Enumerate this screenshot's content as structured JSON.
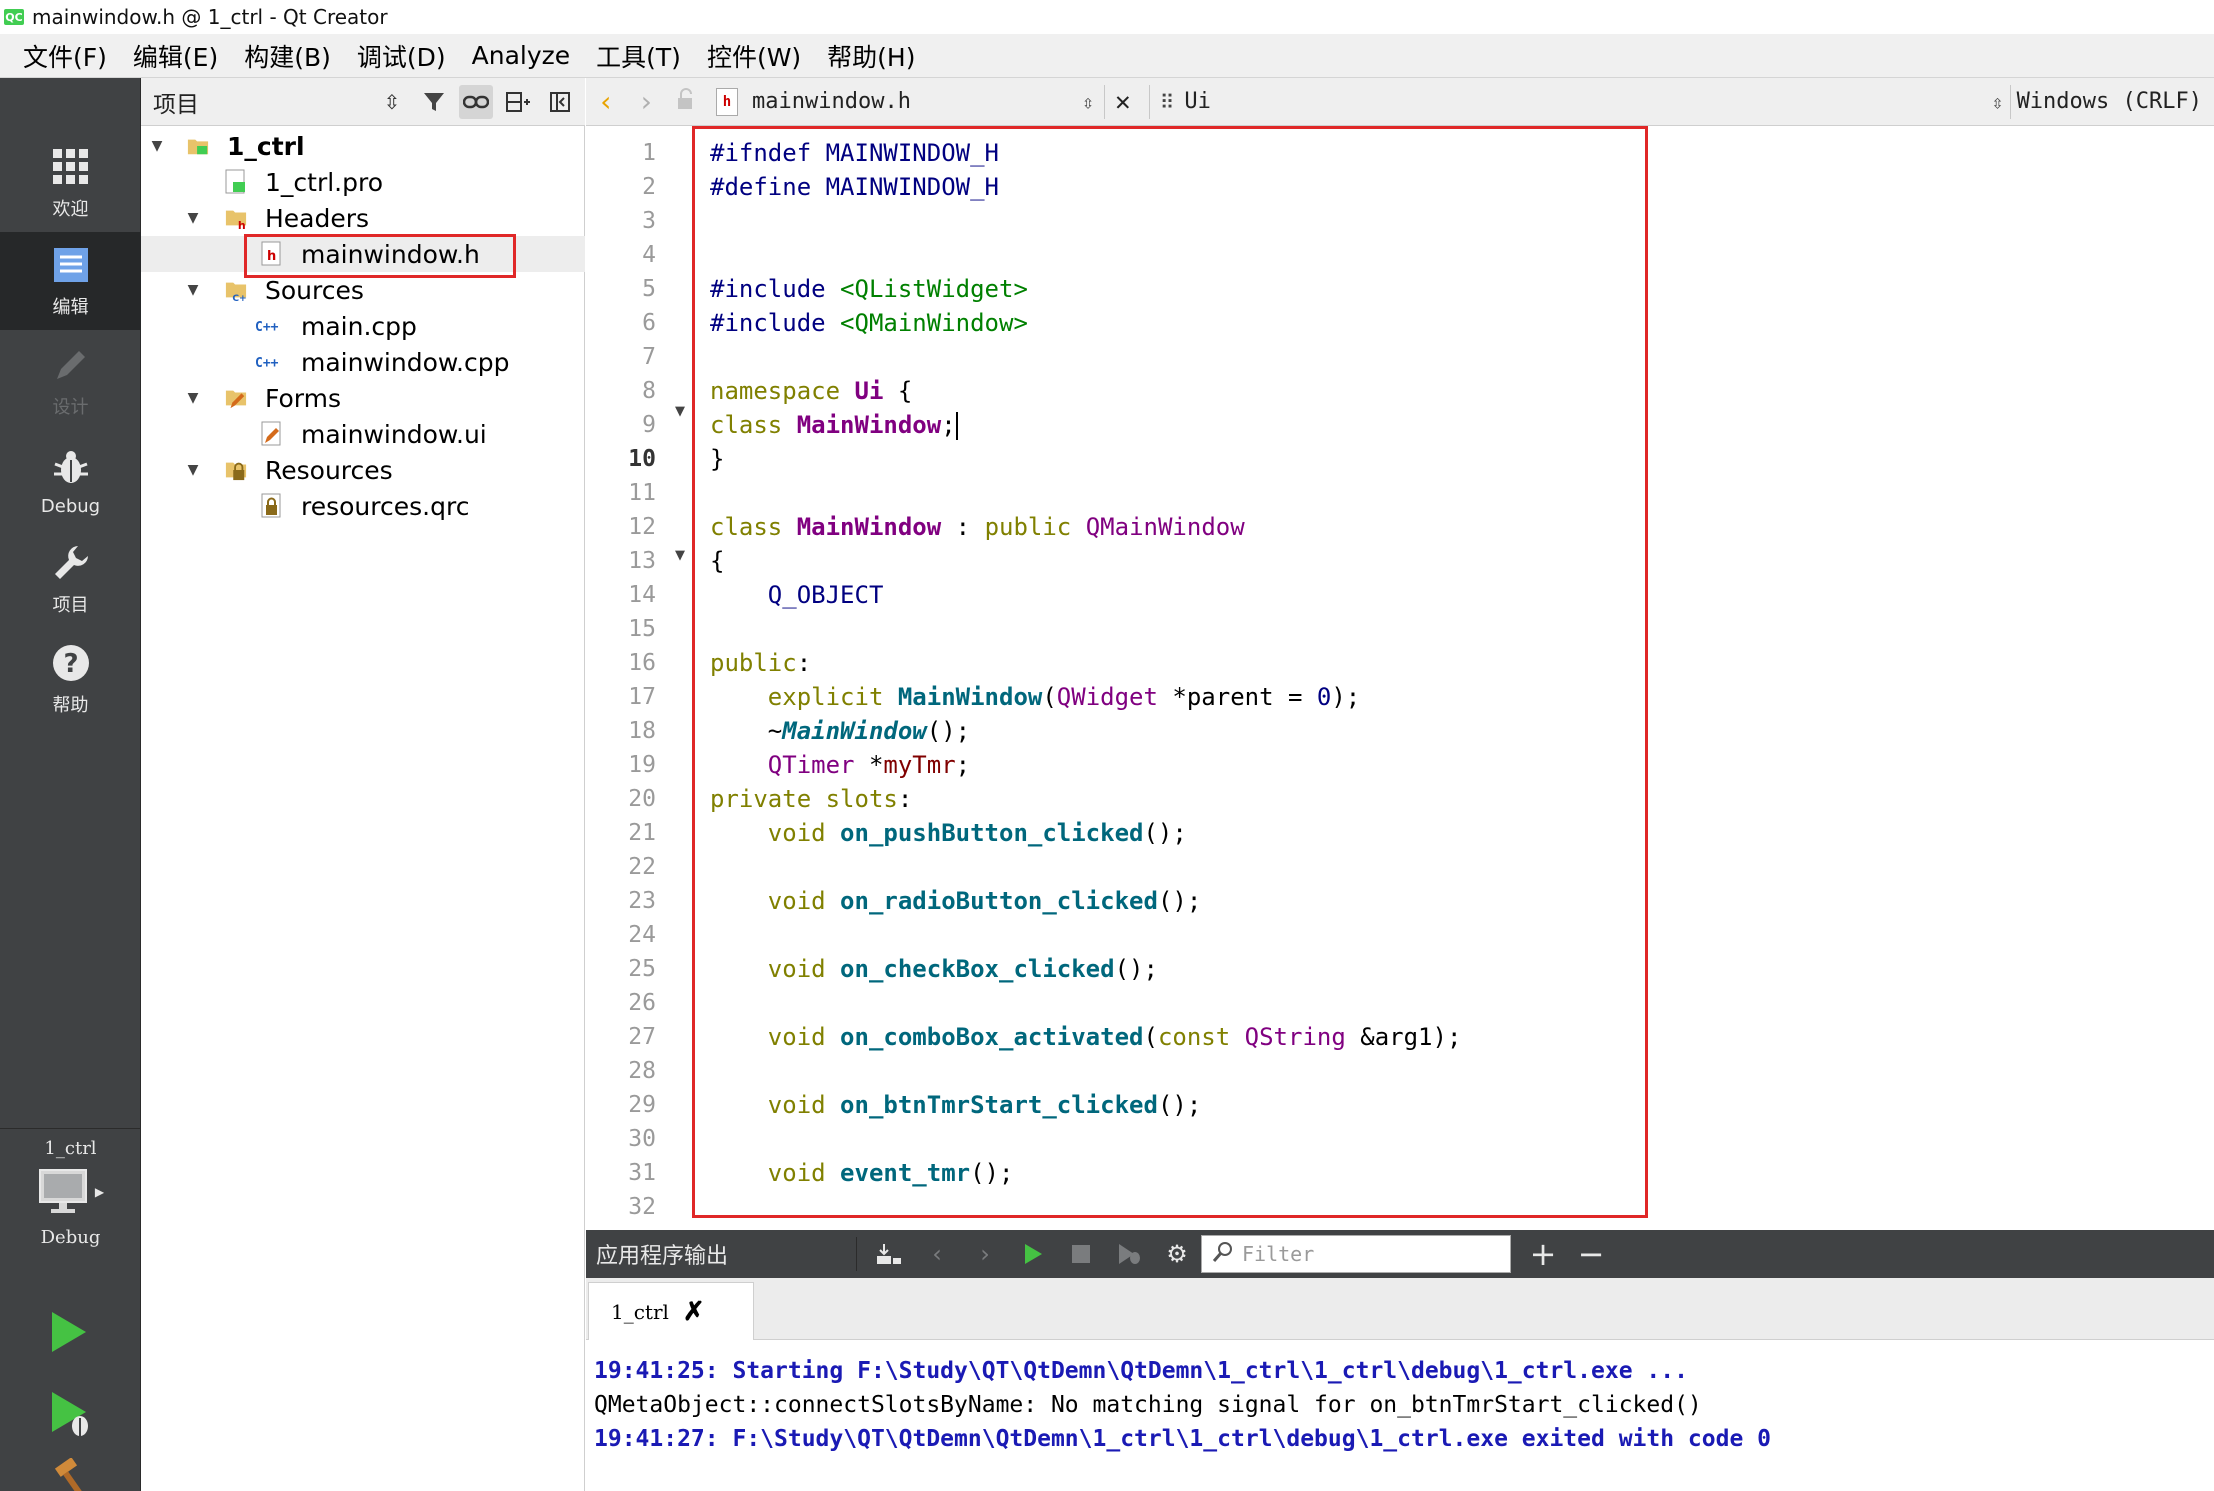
{
  "window": {
    "title": "mainwindow.h @ 1_ctrl - Qt Creator",
    "app_icon": "QC"
  },
  "menubar": {
    "items": [
      "文件(F)",
      "编辑(E)",
      "构建(B)",
      "调试(D)",
      "Analyze",
      "工具(T)",
      "控件(W)",
      "帮助(H)"
    ]
  },
  "modebar": {
    "modes": [
      {
        "label": "欢迎",
        "icon": "grid-icon"
      },
      {
        "label": "编辑",
        "icon": "document-icon"
      },
      {
        "label": "设计",
        "icon": "pencil-icon"
      },
      {
        "label": "Debug",
        "icon": "bug-icon"
      },
      {
        "label": "项目",
        "icon": "wrench-icon"
      },
      {
        "label": "帮助",
        "icon": "help-icon"
      }
    ],
    "kit": {
      "project": "1_ctrl",
      "config": "Debug"
    }
  },
  "project_panel": {
    "title": "项目",
    "tree": [
      {
        "label": "1_ctrl",
        "level": 0,
        "expanded": true,
        "bold": true
      },
      {
        "label": "1_ctrl.pro",
        "level": 1
      },
      {
        "label": "Headers",
        "level": 1,
        "expanded": true
      },
      {
        "label": "mainwindow.h",
        "level": 2,
        "selected": true
      },
      {
        "label": "Sources",
        "level": 1,
        "expanded": true
      },
      {
        "label": "main.cpp",
        "level": 2
      },
      {
        "label": "mainwindow.cpp",
        "level": 2
      },
      {
        "label": "Forms",
        "level": 1,
        "expanded": true
      },
      {
        "label": "mainwindow.ui",
        "level": 2
      },
      {
        "label": "Resources",
        "level": 1,
        "expanded": true
      },
      {
        "label": "resources.qrc",
        "level": 2
      }
    ]
  },
  "editor": {
    "file_name": "mainwindow.h",
    "symbol": "Ui",
    "line_ending": "Windows (CRLF)",
    "current_line": 10,
    "line_numbers": [
      "1",
      "2",
      "3",
      "4",
      "5",
      "6",
      "7",
      "8",
      "9",
      "10",
      "11",
      "12",
      "13",
      "14",
      "15",
      "16",
      "17",
      "18",
      "19",
      "20",
      "21",
      "22",
      "23",
      "24",
      "25",
      "26",
      "27",
      "28",
      "29",
      "30",
      "31",
      "32"
    ],
    "code_lines": [
      "#ifndef MAINWINDOW_H",
      "#define MAINWINDOW_H",
      "",
      "",
      "#include <QListWidget>",
      "#include <QMainWindow>",
      "",
      "",
      "namespace Ui {",
      "class MainWindow;",
      "}",
      "",
      "class MainWindow : public QMainWindow",
      "{",
      "    Q_OBJECT",
      "",
      "public:",
      "    explicit MainWindow(QWidget *parent = 0);",
      "    ~MainWindow();",
      "    QTimer *myTmr;",
      "private slots:",
      "    void on_pushButton_clicked();",
      "",
      "    void on_radioButton_clicked();",
      "",
      "    void on_checkBox_clicked();",
      "",
      "    void on_comboBox_activated(const QString &arg1);",
      "",
      "    void on_btnTmrStart_clicked();",
      "",
      "    void event_tmr();"
    ]
  },
  "output": {
    "title": "应用程序输出",
    "filter_placeholder": "Filter",
    "tab_label": "1_ctrl",
    "lines": [
      "19:41:25: Starting F:\\Study\\QT\\QtDemn\\QtDemn\\1_ctrl\\1_ctrl\\debug\\1_ctrl.exe ...",
      "QMetaObject::connectSlotsByName: No matching signal for on_btnTmrStart_clicked()",
      "19:41:27: F:\\Study\\QT\\QtDemn\\QtDemn\\1_ctrl\\1_ctrl\\debug\\1_ctrl.exe exited with code 0"
    ]
  },
  "colors": {
    "highlight_box": "#e02828",
    "mode_bar": "#404244",
    "run_green": "#45c243",
    "change_marker": "#2da82d"
  }
}
